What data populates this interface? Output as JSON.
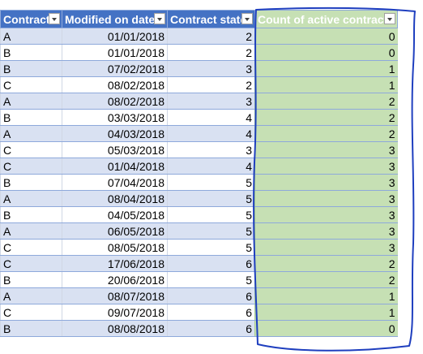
{
  "headers": {
    "contract": "Contract",
    "modified": "Modified on date",
    "state": "Contract state",
    "count": "Count of active contracts"
  },
  "rows": [
    {
      "contract": "A",
      "date": "01/01/2018",
      "state": "2",
      "count": "0"
    },
    {
      "contract": "B",
      "date": "01/01/2018",
      "state": "2",
      "count": "0"
    },
    {
      "contract": "B",
      "date": "07/02/2018",
      "state": "3",
      "count": "1"
    },
    {
      "contract": "C",
      "date": "08/02/2018",
      "state": "2",
      "count": "1"
    },
    {
      "contract": "A",
      "date": "08/02/2018",
      "state": "3",
      "count": "2"
    },
    {
      "contract": "B",
      "date": "03/03/2018",
      "state": "4",
      "count": "2"
    },
    {
      "contract": "A",
      "date": "04/03/2018",
      "state": "4",
      "count": "2"
    },
    {
      "contract": "C",
      "date": "05/03/2018",
      "state": "3",
      "count": "3"
    },
    {
      "contract": "C",
      "date": "01/04/2018",
      "state": "4",
      "count": "3"
    },
    {
      "contract": "B",
      "date": "07/04/2018",
      "state": "5",
      "count": "3"
    },
    {
      "contract": "A",
      "date": "08/04/2018",
      "state": "5",
      "count": "3"
    },
    {
      "contract": "B",
      "date": "04/05/2018",
      "state": "5",
      "count": "3"
    },
    {
      "contract": "A",
      "date": "06/05/2018",
      "state": "5",
      "count": "3"
    },
    {
      "contract": "C",
      "date": "08/05/2018",
      "state": "5",
      "count": "3"
    },
    {
      "contract": "C",
      "date": "17/06/2018",
      "state": "6",
      "count": "2"
    },
    {
      "contract": "B",
      "date": "20/06/2018",
      "state": "5",
      "count": "2"
    },
    {
      "contract": "A",
      "date": "08/07/2018",
      "state": "6",
      "count": "1"
    },
    {
      "contract": "C",
      "date": "09/07/2018",
      "state": "6",
      "count": "1"
    },
    {
      "contract": "B",
      "date": "08/08/2018",
      "state": "6",
      "count": "0"
    }
  ],
  "colors": {
    "header": "#4472c4",
    "band": "#d9e1f2",
    "highlight": "#c6e0b4",
    "annotation": "#1f3fbf"
  },
  "icons": {
    "filter": "filter-dropdown-icon"
  }
}
